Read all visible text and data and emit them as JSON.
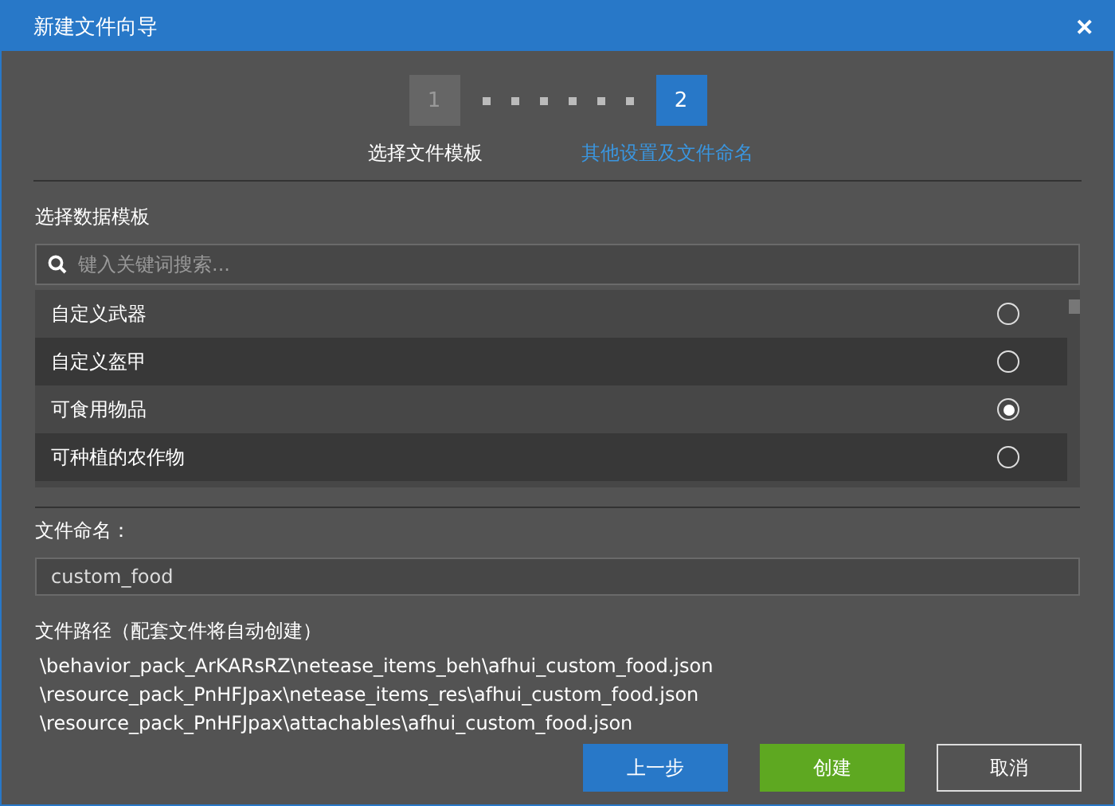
{
  "window": {
    "title": "新建文件向导",
    "close": "✕"
  },
  "steps": [
    {
      "number": "1",
      "label": "选择文件模板",
      "selected": false
    },
    {
      "number": "2",
      "label": "其他设置及文件命名",
      "selected": true
    }
  ],
  "template_section": {
    "label": "选择数据模板",
    "search": {
      "placeholder": "键入关键词搜索..."
    },
    "items": [
      {
        "name": "自定义武器",
        "selected": false
      },
      {
        "name": "自定义盔甲",
        "selected": false
      },
      {
        "name": "可食用物品",
        "selected": true
      },
      {
        "name": "可种植的农作物",
        "selected": false
      }
    ]
  },
  "file_name": {
    "label": "文件命名：",
    "value": "custom_food"
  },
  "file_path": {
    "label": "文件路径（配套文件将自动创建）",
    "paths": [
      "\\behavior_pack_ArKARsRZ\\netease_items_beh\\afhui_custom_food.json",
      "\\resource_pack_PnHFJpax\\netease_items_res\\afhui_custom_food.json",
      "\\resource_pack_PnHFJpax\\attachables\\afhui_custom_food.json"
    ]
  },
  "buttons": [
    {
      "label": "上一步",
      "kind": "secondary"
    },
    {
      "label": "创建",
      "kind": "primary"
    },
    {
      "label": "取消",
      "kind": "cancel"
    }
  ]
}
